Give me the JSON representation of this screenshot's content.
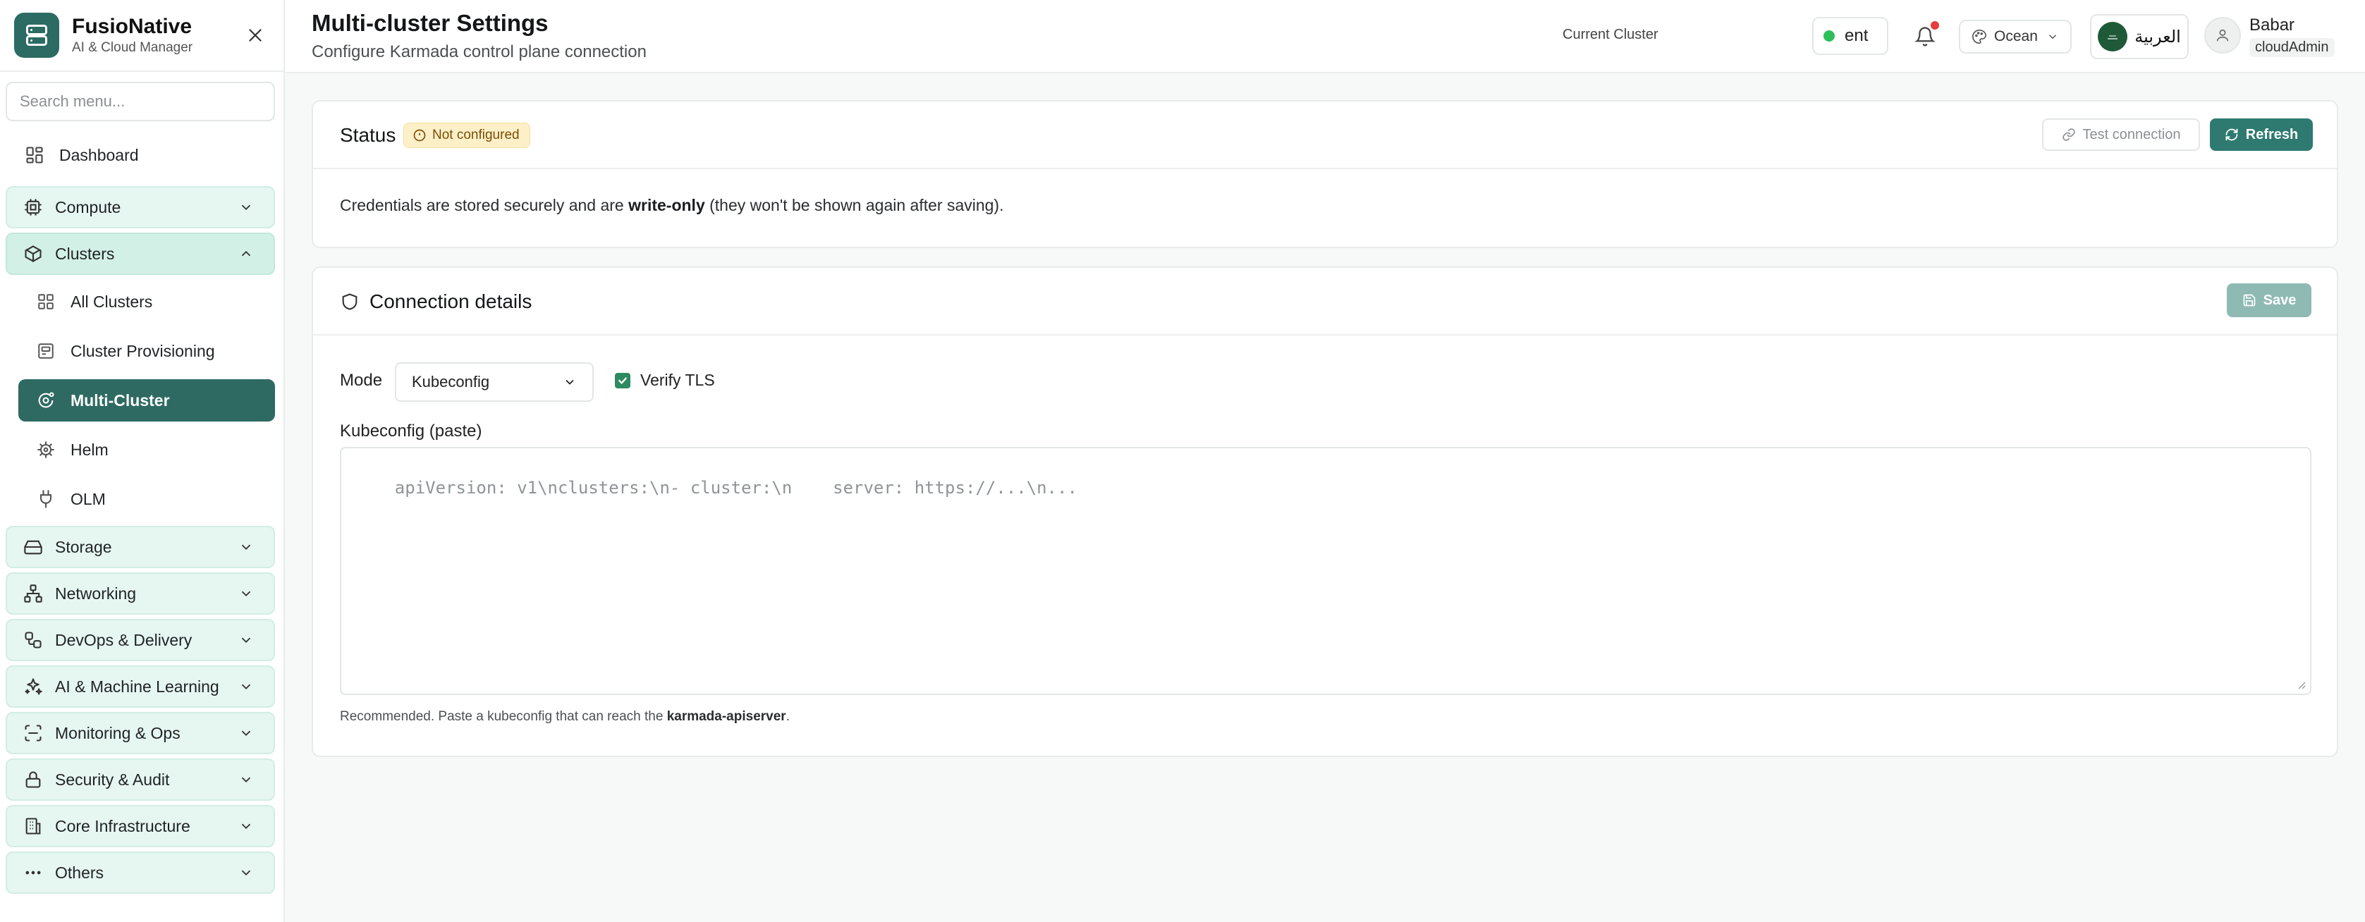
{
  "brand": {
    "title": "FusioNative",
    "subtitle": "AI & Cloud Manager"
  },
  "search": {
    "placeholder": "Search menu..."
  },
  "sidebar": {
    "items": [
      {
        "label": "Dashboard",
        "icon": "grid-icon"
      },
      {
        "label": "Compute",
        "icon": "cpu-icon"
      },
      {
        "label": "Clusters",
        "icon": "box-icon"
      },
      {
        "label": "All Clusters",
        "icon": "grid-icon"
      },
      {
        "label": "Cluster Provisioning",
        "icon": "server-icon"
      },
      {
        "label": "Multi-Cluster",
        "icon": "orbit-icon"
      },
      {
        "label": "Helm",
        "icon": "helm-icon"
      },
      {
        "label": "OLM",
        "icon": "plug-icon"
      },
      {
        "label": "Storage",
        "icon": "hard-drive-icon"
      },
      {
        "label": "Networking",
        "icon": "network-icon"
      },
      {
        "label": "DevOps & Delivery",
        "icon": "workflow-icon"
      },
      {
        "label": "AI & Machine Learning",
        "icon": "sparkles-icon"
      },
      {
        "label": "Monitoring & Ops",
        "icon": "scan-icon"
      },
      {
        "label": "Security & Audit",
        "icon": "lock-icon"
      },
      {
        "label": "Core Infrastructure",
        "icon": "building-icon"
      },
      {
        "label": "Others",
        "icon": "more-icon"
      }
    ]
  },
  "header": {
    "title": "Multi-cluster Settings",
    "subtitle": "Configure Karmada control plane connection",
    "current_cluster_label": "Current Cluster",
    "current_cluster": "ent",
    "theme": "Ocean",
    "language": "العربية",
    "user_name": "Babar",
    "user_role": "cloudAdmin"
  },
  "status": {
    "title": "Status",
    "badge": "Not configured",
    "test_button": "Test connection",
    "refresh_button": "Refresh",
    "note_before": "Credentials are stored securely and are ",
    "note_bold": "write-only",
    "note_after": " (they won't be shown again after saving)."
  },
  "connection": {
    "title": "Connection details",
    "save_button": "Save",
    "mode_label": "Mode",
    "mode_value": "Kubeconfig",
    "verify_tls_label": "Verify TLS",
    "verify_tls_checked": true,
    "kubeconfig_label": "Kubeconfig (paste)",
    "kubeconfig_placeholder": "apiVersion: v1\\nclusters:\\n- cluster:\\n    server: https://...\\n...",
    "help_before": "Recommended. Paste a kubeconfig that can reach the ",
    "help_bold": "karmada-apiserver",
    "help_after": "."
  },
  "colors": {
    "accent": "#2e6a62",
    "section_bg": "#e6f6f1",
    "badge_bg": "#fdf0c8",
    "status_green": "#2fbf5a",
    "notify_red": "#e53b3b"
  }
}
